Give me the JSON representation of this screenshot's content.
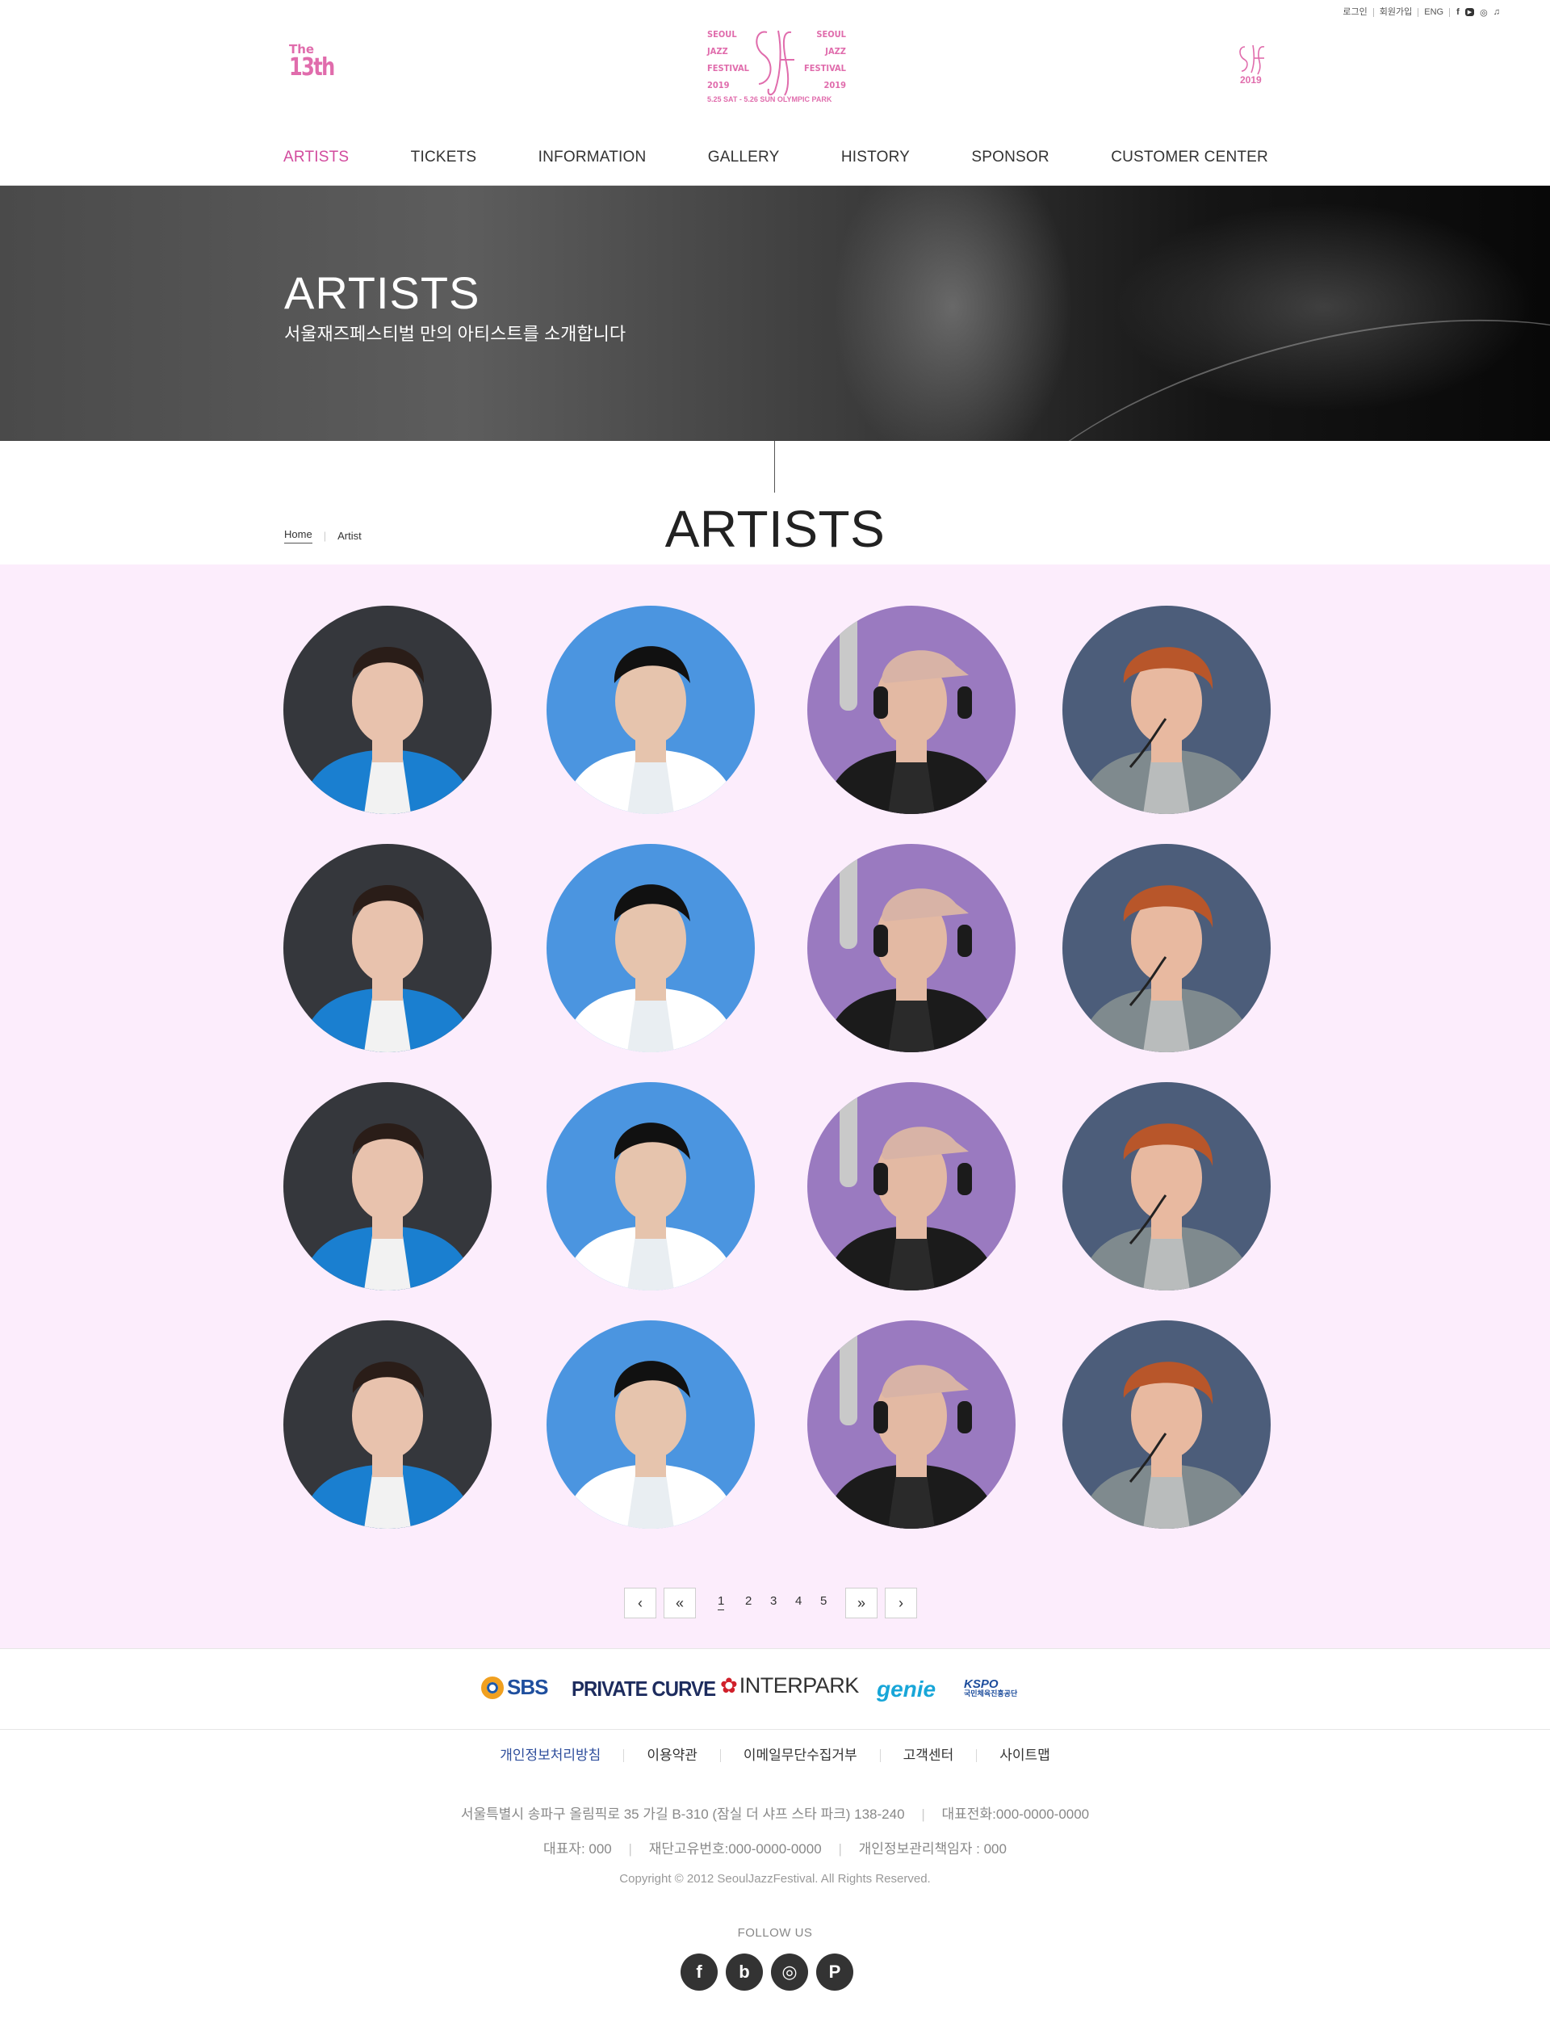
{
  "util": {
    "login": "로그인",
    "signup": "회원가입",
    "lang": "ENG",
    "socials": [
      "f",
      "▶",
      "◎",
      "♫"
    ]
  },
  "header": {
    "edition_the": "The",
    "edition_num": "13th",
    "logo_left": [
      "SEOUL",
      "JAZZ",
      "FESTIVAL",
      "2019"
    ],
    "logo_right": [
      "SEOUL",
      "JAZZ",
      "FESTIVAL",
      "2019"
    ],
    "logo_bottom": "5.25 SAT - 5.26 SUN OLYMPIC PARK",
    "mini_logo_year": "2019",
    "brand_color": "#e06cac"
  },
  "nav": [
    "ARTISTS",
    "TICKETS",
    "INFORMATION",
    "GALLERY",
    "HISTORY",
    "SPONSOR",
    "CUSTOMER CENTER"
  ],
  "hero": {
    "title": "ARTISTS",
    "subtitle": "서울재즈페스티벌 만의 아티스트를 소개합니다"
  },
  "breadcrumb": {
    "home": "Home",
    "current": "Artist"
  },
  "page_title": "ARTISTS",
  "artists": {
    "rows": 4,
    "columns": [
      {
        "name": "artist-blue-jacket",
        "bg": "#35373c"
      },
      {
        "name": "artist-profile-blue",
        "bg": "#4b95e0"
      },
      {
        "name": "artist-cap-mic",
        "bg": "#9a7ac0"
      },
      {
        "name": "artist-red-hair",
        "bg": "#4c5d7a"
      }
    ]
  },
  "pagination": {
    "prev": "‹",
    "first": "«",
    "pages": [
      "1",
      "2",
      "3",
      "4",
      "5"
    ],
    "current": "1",
    "last": "»",
    "next": "›"
  },
  "sponsors": [
    "SBS",
    "PRIVATE CURVE",
    "INTERPARK",
    "genie",
    "KSPO",
    "국민체육진흥공단"
  ],
  "footer": {
    "links": [
      "개인정보처리방침",
      "이용약관",
      "이메일무단수집거부",
      "고객센터",
      "사이트맵"
    ],
    "address": "서울특별시 송파구 올림픽로 35 가길 B-310 (잠실 더 샤프 스타 파크) 138-240",
    "phone": "대표전화:000-0000-0000",
    "ceo": "대표자: 000",
    "biz_no": "재단고유번호:000-0000-0000",
    "privacy_officer": "개인정보관리책임자 : 000",
    "copyright": "Copyright © 2012 SeoulJazzFestival. All Rights Reserved.",
    "follow": "FOLLOW US",
    "follow_icons": [
      "f",
      "b",
      "◎",
      "P"
    ]
  }
}
